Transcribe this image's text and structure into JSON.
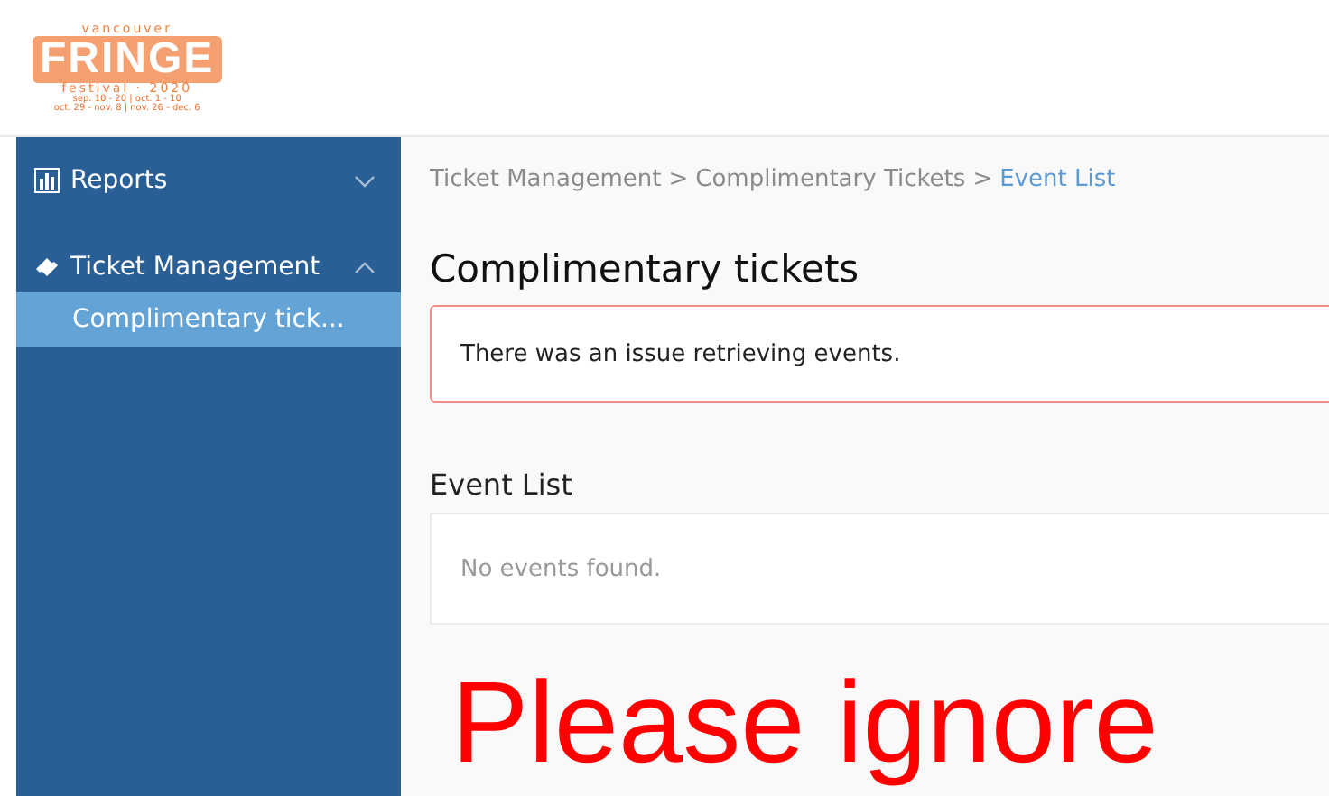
{
  "logo": {
    "top": "vancouver",
    "name": "FRINGE",
    "subtitle": "festival · 2020",
    "dates": [
      "sep. 10 - 20 | oct. 1 - 10",
      "oct. 29 - nov. 8 | nov. 26 - dec. 6"
    ]
  },
  "sidebar": {
    "items": [
      {
        "label": "Reports",
        "expanded": false
      },
      {
        "label": "Ticket Management",
        "expanded": true,
        "children": [
          {
            "label": "Complimentary tick...",
            "selected": true
          }
        ]
      }
    ]
  },
  "breadcrumb": [
    {
      "label": "Ticket Management",
      "current": false
    },
    {
      "label": "Complimentary Tickets",
      "current": false
    },
    {
      "label": "Event List",
      "current": true
    }
  ],
  "breadcrumb_separator": ">",
  "title": "Complimentary tickets",
  "alert": "There was an issue retrieving events.",
  "event_list": {
    "heading": "Event List",
    "empty_text": "No events found."
  },
  "annotation": "Please ignore"
}
